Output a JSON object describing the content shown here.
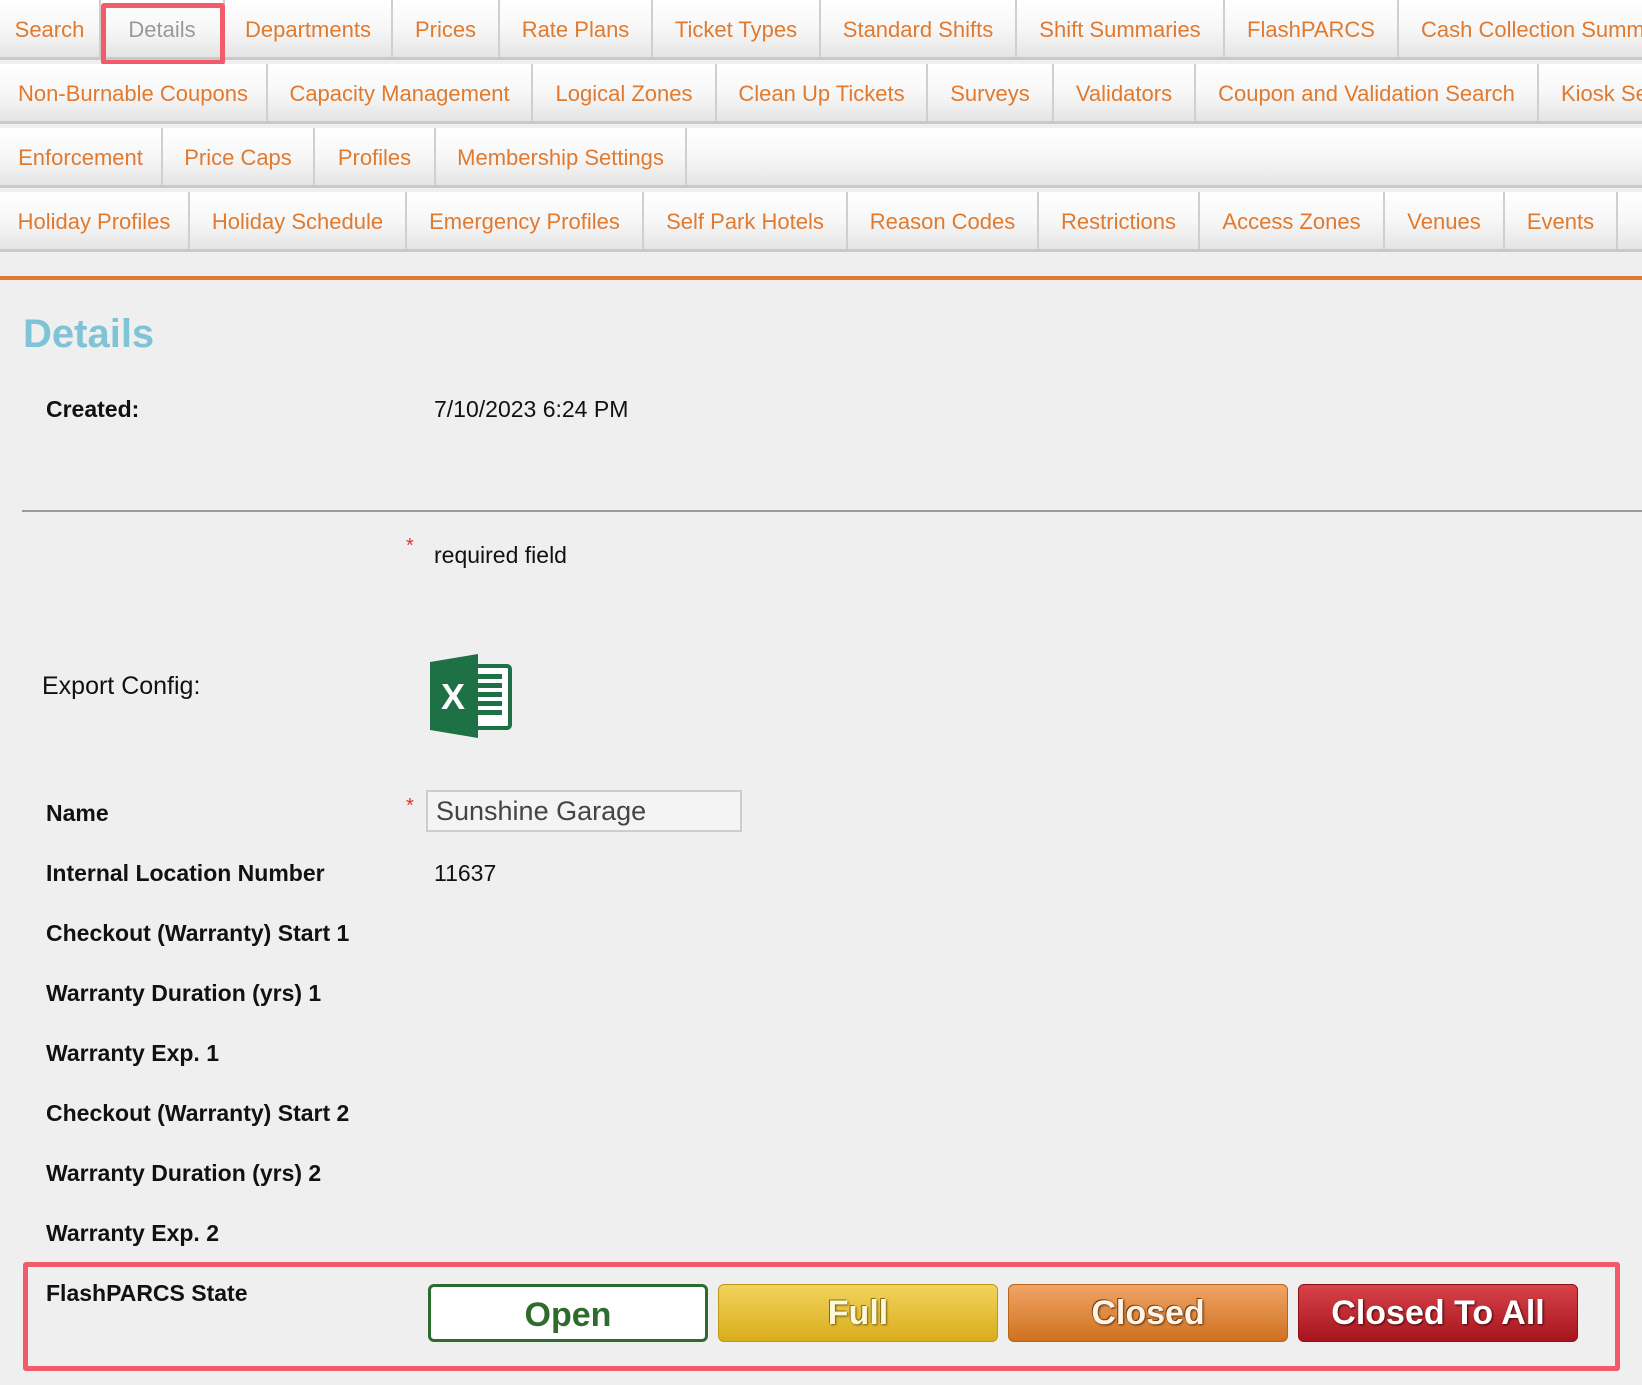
{
  "tabs": {
    "row1": [
      "Search",
      "Details",
      "Departments",
      "Prices",
      "Rate Plans",
      "Ticket Types",
      "Standard Shifts",
      "Shift Summaries",
      "FlashPARCS",
      "Cash Collection Summ"
    ],
    "row2": [
      "Non-Burnable Coupons",
      "Capacity Management",
      "Logical Zones",
      "Clean Up Tickets",
      "Surveys",
      "Validators",
      "Coupon and Validation Search",
      "Kiosk Se"
    ],
    "row3": [
      "Enforcement",
      "Price Caps",
      "Profiles",
      "Membership Settings"
    ],
    "row4": [
      "Holiday Profiles",
      "Holiday Schedule",
      "Emergency Profiles",
      "Self Park Hotels",
      "Reason Codes",
      "Restrictions",
      "Access Zones",
      "Venues",
      "Events"
    ],
    "selected": "Details"
  },
  "page": {
    "title": "Details",
    "created_label": "Created:",
    "created_value": "7/10/2023 6:24 PM",
    "required_star": "*",
    "required_note": "required field",
    "export_label": "Export Config:",
    "export_icon": "excel-icon"
  },
  "form": {
    "name_label": "Name",
    "name_value": "Sunshine Garage",
    "internal_location_label": "Internal Location Number",
    "internal_location_value": "11637",
    "checkout_start_1": "Checkout (Warranty) Start 1",
    "warranty_duration_1": "Warranty Duration (yrs) 1",
    "warranty_exp_1": "Warranty Exp. 1",
    "checkout_start_2": "Checkout (Warranty) Start 2",
    "warranty_duration_2": "Warranty Duration (yrs) 2",
    "warranty_exp_2": "Warranty Exp. 2",
    "flashparcs_state_label": "FlashPARCS State"
  },
  "states": {
    "open": "Open",
    "full": "Full",
    "closed": "Closed",
    "closed_to_all": "Closed To All"
  },
  "colors": {
    "tab_text": "#e07a2f",
    "tab_selected_text": "#999999",
    "title": "#7ec4d6",
    "highlight": "#f25c6a",
    "accent_rule": "#e07a2f"
  }
}
